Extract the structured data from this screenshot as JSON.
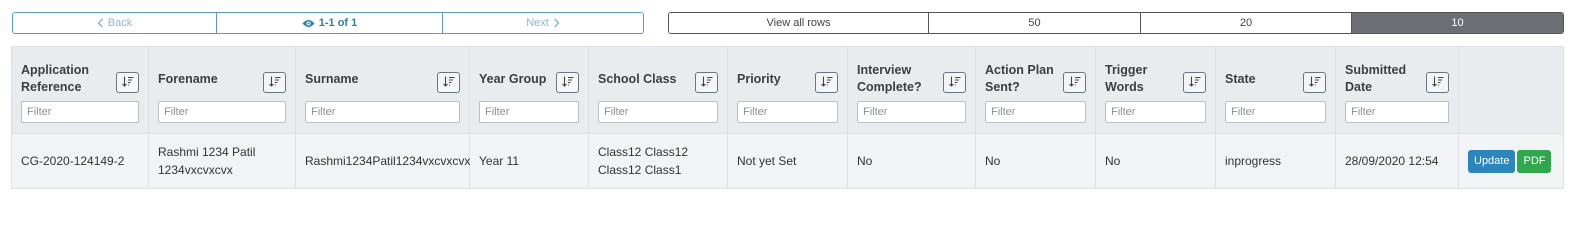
{
  "pager": {
    "back_label": "Back",
    "current_label": "1-1 of 1",
    "next_label": "Next"
  },
  "page_size": {
    "options": [
      "View all rows",
      "50",
      "20",
      "10"
    ],
    "selected": "10"
  },
  "table": {
    "filter_placeholder": "Filter",
    "columns": [
      "Application Reference",
      "Forename",
      "Surname",
      "Year Group",
      "School Class",
      "Priority",
      "Interview Complete?",
      "Action Plan Sent?",
      "Trigger Words",
      "State",
      "Submitted Date"
    ],
    "rows": [
      {
        "application_reference": "CG-2020-124149-2",
        "forename": "Rashmi 1234 Patil 1234vxcvxcvx",
        "surname": "Rashmi1234Patil1234vxcvxcvx",
        "year_group": "Year 11",
        "school_class": "Class12 Class12 Class12 Class1",
        "priority": "Not yet Set",
        "interview_complete": "No",
        "action_plan_sent": "No",
        "trigger_words": "No",
        "state": "inprogress",
        "submitted_date": "28/09/2020 12:54",
        "update_label": "Update",
        "pdf_label": "PDF"
      }
    ]
  },
  "colors": {
    "pager_border": "#5a9bc0",
    "active_size_bg": "#6b6f74",
    "update_button": "#2a86bd",
    "pdf_button": "#2ea84a",
    "header_bg": "#e9ecef"
  },
  "icons": {
    "back": "chevron-left-icon",
    "current": "eye-icon",
    "next": "chevron-right-icon",
    "sort": "sort-amount-down-icon"
  }
}
